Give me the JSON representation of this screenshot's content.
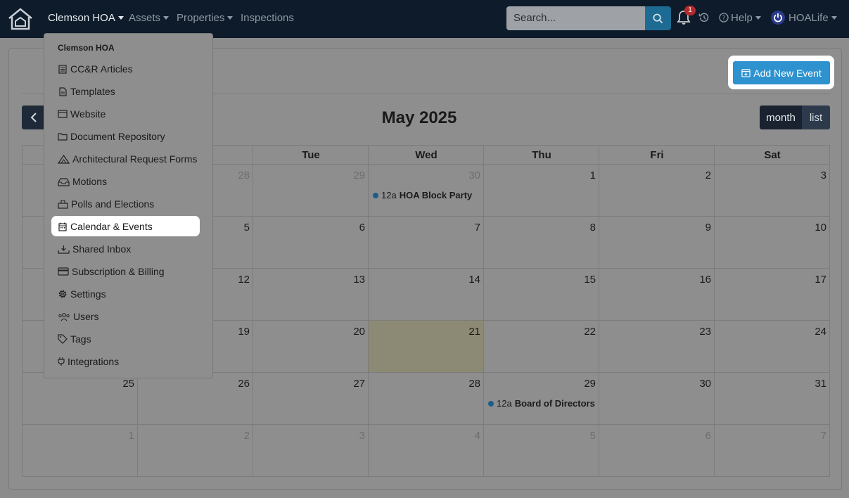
{
  "nav": {
    "org": "Clemson HOA",
    "items": [
      "Assets",
      "Properties",
      "Inspections"
    ],
    "search_placeholder": "Search...",
    "notifications": "1",
    "help": "Help",
    "user": "HOALife"
  },
  "header": {
    "add_event": "Add New Event"
  },
  "calendar": {
    "title": "May 2025",
    "views": {
      "month": "month",
      "list": "list"
    },
    "weekdays": [
      "Tue",
      "Wed",
      "Thu",
      "Fri",
      "Sat"
    ],
    "weeks": [
      [
        "",
        "28",
        "29",
        "30",
        "1",
        "2",
        "3"
      ],
      [
        "",
        "5",
        "6",
        "7",
        "8",
        "9",
        "10"
      ],
      [
        "",
        "12",
        "13",
        "14",
        "15",
        "16",
        "17"
      ],
      [
        "",
        "19",
        "20",
        "21",
        "22",
        "23",
        "24"
      ],
      [
        "25",
        "26",
        "27",
        "28",
        "29",
        "30",
        "31"
      ],
      [
        "1",
        "2",
        "3",
        "4",
        "5",
        "6",
        "7"
      ]
    ],
    "events": [
      {
        "time": "12a",
        "title": "HOA Block Party"
      },
      {
        "time": "12a",
        "title": "Board of Directors M"
      }
    ]
  },
  "dropdown": {
    "header": "Clemson HOA",
    "items": [
      {
        "label": "CC&R Articles",
        "icon": "book-icon"
      },
      {
        "label": "Templates",
        "icon": "file-icon"
      },
      {
        "label": "Website",
        "icon": "window-icon"
      },
      {
        "label": "Document Repository",
        "icon": "folder-icon"
      },
      {
        "label": "Architectural Request Forms",
        "icon": "warning-icon"
      },
      {
        "label": "Motions",
        "icon": "inbox-icon"
      },
      {
        "label": "Polls and Elections",
        "icon": "vote-icon"
      },
      {
        "label": "Calendar & Events",
        "icon": "calendar-icon"
      },
      {
        "label": "Shared Inbox",
        "icon": "download-icon"
      },
      {
        "label": "Subscription & Billing",
        "icon": "credit-card-icon"
      },
      {
        "label": "Settings",
        "icon": "gear-icon"
      },
      {
        "label": "Users",
        "icon": "users-icon"
      },
      {
        "label": "Tags",
        "icon": "tag-icon"
      },
      {
        "label": "Integrations",
        "icon": "plug-icon"
      }
    ]
  },
  "colors": {
    "navbar": "#0d1b2a",
    "primary_button": "#2e92cf",
    "event_dot": "#1d5c8a"
  }
}
